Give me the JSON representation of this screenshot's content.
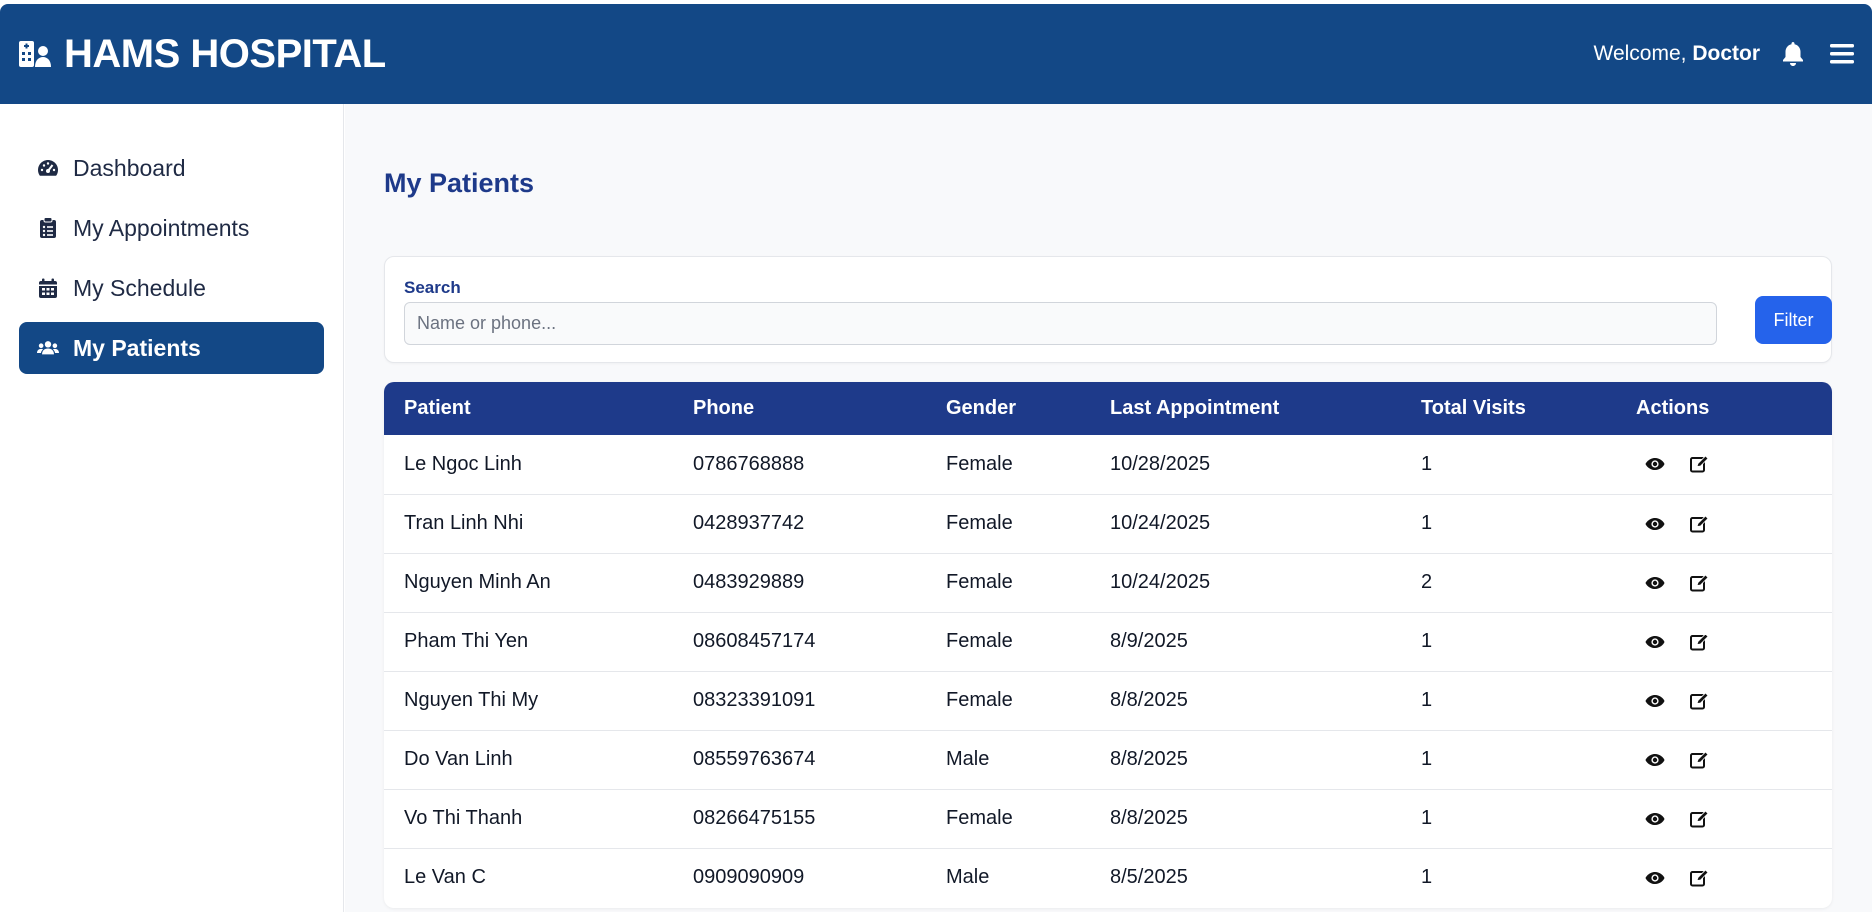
{
  "header": {
    "title": "HAMS HOSPITAL",
    "welcome_prefix": "Welcome, ",
    "welcome_user": "Doctor",
    "brand_color": "#134886"
  },
  "sidebar": {
    "items": [
      {
        "label": "Dashboard",
        "icon": "gauge-icon",
        "active": false
      },
      {
        "label": "My Appointments",
        "icon": "clipboard-list-icon",
        "active": false
      },
      {
        "label": "My Schedule",
        "icon": "calendar-icon",
        "active": false
      },
      {
        "label": "My Patients",
        "icon": "users-icon",
        "active": true
      }
    ]
  },
  "main": {
    "page_title": "My Patients",
    "search": {
      "label": "Search",
      "placeholder": "Name or phone...",
      "value": "",
      "filter_label": "Filter"
    },
    "table": {
      "columns": [
        "Patient",
        "Phone",
        "Gender",
        "Last Appointment",
        "Total Visits",
        "Actions"
      ],
      "rows": [
        {
          "patient": "Le Ngoc Linh",
          "phone": "0786768888",
          "gender": "Female",
          "last": "10/28/2025",
          "visits": "1"
        },
        {
          "patient": "Tran Linh Nhi",
          "phone": "0428937742",
          "gender": "Female",
          "last": "10/24/2025",
          "visits": "1"
        },
        {
          "patient": "Nguyen Minh An",
          "phone": "0483929889",
          "gender": "Female",
          "last": "10/24/2025",
          "visits": "2"
        },
        {
          "patient": "Pham Thi Yen",
          "phone": "08608457174",
          "gender": "Female",
          "last": "8/9/2025",
          "visits": "1"
        },
        {
          "patient": "Nguyen Thi My",
          "phone": "08323391091",
          "gender": "Female",
          "last": "8/8/2025",
          "visits": "1"
        },
        {
          "patient": "Do Van Linh",
          "phone": "08559763674",
          "gender": "Male",
          "last": "8/8/2025",
          "visits": "1"
        },
        {
          "patient": "Vo Thi Thanh",
          "phone": "08266475155",
          "gender": "Female",
          "last": "8/8/2025",
          "visits": "1"
        },
        {
          "patient": "Le Van C",
          "phone": "0909090909",
          "gender": "Male",
          "last": "8/5/2025",
          "visits": "1"
        }
      ]
    },
    "accent_color": "#2563eb",
    "table_header_color": "#1e3a8a"
  }
}
